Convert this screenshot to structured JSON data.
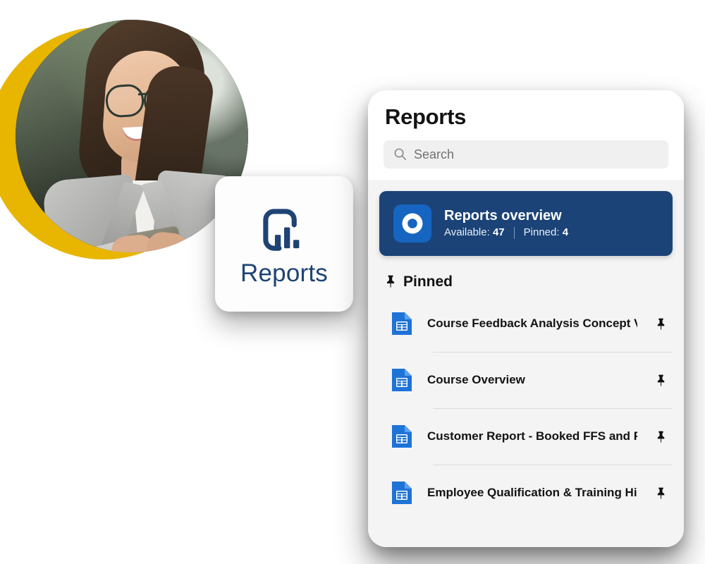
{
  "tile": {
    "label": "Reports",
    "icon": "reports-bar-chart-icon",
    "accent_color": "#1e4374"
  },
  "panel": {
    "title": "Reports",
    "search": {
      "placeholder": "Search",
      "value": "",
      "icon": "search-icon"
    },
    "overview": {
      "icon": "donut-chart-icon",
      "title": "Reports overview",
      "available_label": "Available:",
      "available_count": "47",
      "pinned_label": "Pinned:",
      "pinned_count": "4",
      "background_color": "#1b4377",
      "icon_tile_color": "#1665c0"
    },
    "pinned_section": {
      "icon": "pin-icon",
      "label": "Pinned",
      "items": [
        {
          "icon": "spreadsheet-file-icon",
          "label": "Course Feedback Analysis Concept Ver…",
          "pin_icon": "pin-icon"
        },
        {
          "icon": "spreadsheet-file-icon",
          "label": "Course Overview",
          "pin_icon": "pin-icon"
        },
        {
          "icon": "spreadsheet-file-icon",
          "label": "Customer Report - Booked FFS and FP…",
          "pin_icon": "pin-icon"
        },
        {
          "icon": "spreadsheet-file-icon",
          "label": "Employee Qualification & Training His…",
          "pin_icon": "pin-icon"
        }
      ]
    }
  },
  "decor": {
    "accent_circle_color": "#e8b500",
    "photo_alt": "smiling-woman-with-glasses-holding-phone"
  }
}
